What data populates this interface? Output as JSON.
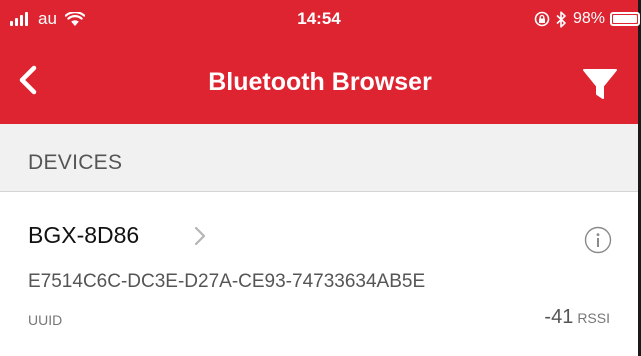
{
  "status_bar": {
    "carrier": "au",
    "time": "14:54",
    "battery_percent": "98%",
    "battery_level": 0.98,
    "icons": [
      "signal-icon",
      "wifi-icon",
      "location-lock-icon",
      "bluetooth-icon",
      "battery-icon"
    ]
  },
  "navbar": {
    "title": "Bluetooth Browser",
    "back_icon": "chevron-left-icon",
    "filter_icon": "filter-icon"
  },
  "section": {
    "title": "DEVICES"
  },
  "devices": [
    {
      "name": "BGX-8D86",
      "uuid": "E7514C6C-DC3E-D27A-CE93-74733634AB5E",
      "uuid_label": "UUID",
      "rssi_value": "-41",
      "rssi_unit": "RSSI"
    }
  ],
  "colors": {
    "accent": "#de2431",
    "section_bg": "#f1f1f1",
    "text_primary": "#111111",
    "text_secondary": "#555555"
  }
}
